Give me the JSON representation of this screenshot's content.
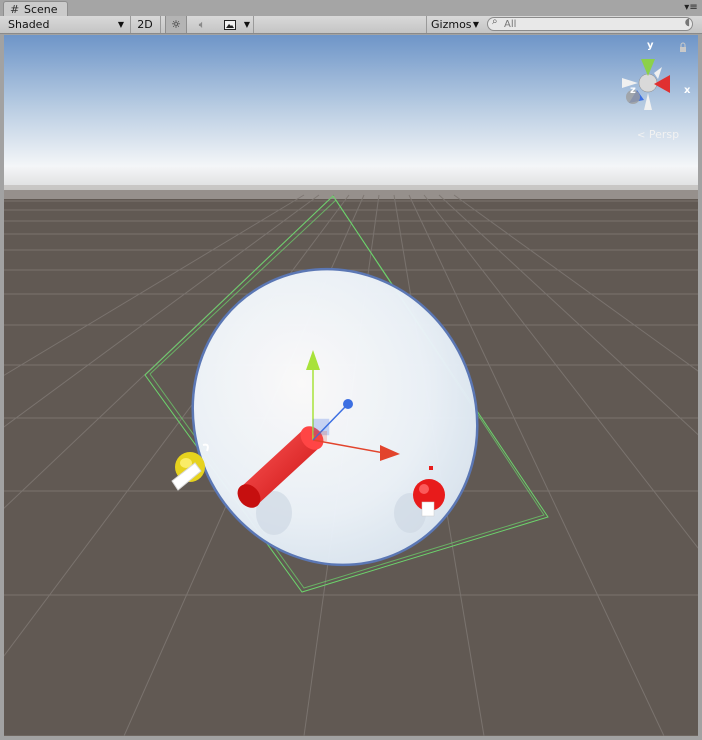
{
  "window": {
    "tab_title": "Scene",
    "tab_menu_icon": "menu-icon"
  },
  "toolbar": {
    "draw_mode": "Shaded",
    "mode_2d_label": "2D",
    "lighting_icon": "sun-icon",
    "audio_icon": "speaker-icon",
    "effects_icon": "image-icon",
    "gizmos_label": "Gizmos",
    "search_placeholder": "All"
  },
  "scene_gizmo": {
    "projection_label": "Persp",
    "axis_x": "x",
    "axis_y": "y",
    "axis_z": "z"
  },
  "colors": {
    "sky_top": "#6e95c8",
    "sky_horizon": "#f4f6f8",
    "ground": "#615953",
    "grid": "#7d7671",
    "selection_outline": "#5fc35f",
    "handle_x": "#e2442c",
    "handle_y": "#a8e23a",
    "handle_z": "#3c6fe2",
    "red_object": "#e81b1b",
    "yellow_object": "#e6d21e"
  }
}
